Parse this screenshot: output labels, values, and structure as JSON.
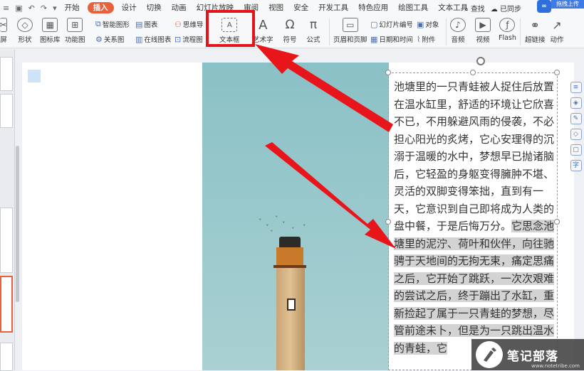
{
  "menubar": {
    "tabs": [
      "开始",
      "插入",
      "设计",
      "切换",
      "动画",
      "幻灯片放映",
      "审阅",
      "视图",
      "安全",
      "开发工具",
      "特色应用",
      "绘图工具",
      "文本工具"
    ],
    "active_tab": "插入",
    "search": "查找",
    "sync": "已同步",
    "upload": "拖拽上传"
  },
  "ribbon": {
    "screenshot": "屏",
    "shape": "形状",
    "icon_lib": "图标库",
    "function_chart": "功能图",
    "smart_shape": "智能图形",
    "relation_chart": "关系图",
    "chart": "图表",
    "online_chart": "在线图表",
    "mind_map": "思维导",
    "flowchart": "流程图",
    "textbox": "文本框",
    "art_text": "艺术字",
    "symbol": "符号",
    "formula": "公式",
    "header_footer": "页眉和页脚",
    "slide_number": "幻灯片编号",
    "object": "对象",
    "datetime": "日期和时间",
    "attachment": "附件",
    "audio": "音频",
    "video": "视频",
    "flash": "Flash",
    "hyperlink": "超链接",
    "action": "动作"
  },
  "slide": {
    "text_normal": "池塘里的一只青蛙被人捉住后放置在温水缸里，舒适的环境让它欣喜不已，不用躲避风雨的侵袭，不必担心阳光的炙烤，它心安理得的沉溺于温暖的水中，梦想早已抛诸脑后，它轻盈的身躯变得臃肿不堪、灵活的双脚变得笨拙，直到有一天，它意识到自己即将成为人类的盘中餐，于是后悔万分。",
    "text_selected": "它思念池塘里的泥泞、荷叶和伙伴，向往驰骋于天地间的无拘无束，痛定思痛之后，它开始了跳跃，一次次艰难的尝试之后，终于蹦出了水缸，重新捡起了属于一只青蛙的梦想，尽管前途未卜，但是为一只跳出温水的青蛙，它"
  },
  "watermark": {
    "title": "笔记部落",
    "url": "www.notetribe.com"
  },
  "colors": {
    "accent": "#e8603c",
    "highlight": "#e4141b",
    "arrow": "#e8151b"
  }
}
